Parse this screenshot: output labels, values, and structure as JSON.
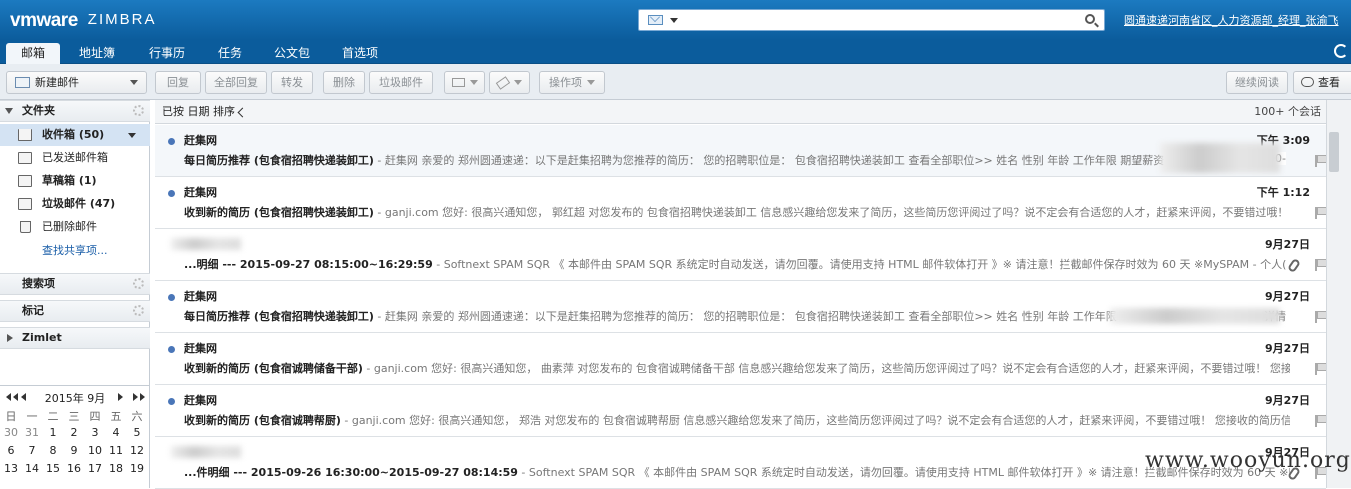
{
  "header": {
    "brand_vm": "vmware",
    "brand_zimbra": "ZIMBRA",
    "user": "圆通速递河南省区_人力资源部_经理_张渝飞",
    "search": {
      "placeholder": "",
      "type_icon": "mail-icon"
    }
  },
  "app_tabs": [
    {
      "label": "邮箱",
      "active": true
    },
    {
      "label": "地址簿",
      "active": false
    },
    {
      "label": "行事历",
      "active": false
    },
    {
      "label": "任务",
      "active": false
    },
    {
      "label": "公文包",
      "active": false
    },
    {
      "label": "首选项",
      "active": false
    }
  ],
  "toolbar": {
    "new_mail": "新建邮件",
    "reply": "回复",
    "reply_all": "全部回复",
    "forward": "转发",
    "delete": "删除",
    "junk": "垃圾邮件",
    "actions": "操作项",
    "continue_read": "继续阅读",
    "view": "查看"
  },
  "sidebar": {
    "folders_header": "文件夹",
    "folders": [
      {
        "label": "收件箱 (50)",
        "icon": "inbox-icon",
        "selected": true,
        "bold": true
      },
      {
        "label": "已发送邮件箱",
        "icon": "sent-icon",
        "selected": false,
        "bold": false
      },
      {
        "label": "草稿箱 (1)",
        "icon": "drafts-icon",
        "selected": false,
        "bold": true
      },
      {
        "label": "垃圾邮件 (47)",
        "icon": "junk-icon",
        "selected": false,
        "bold": true
      },
      {
        "label": "已删除邮件",
        "icon": "trash-icon",
        "selected": false,
        "bold": false
      }
    ],
    "find_shares": "查找共享项...",
    "searches_header": "搜索项",
    "tags_header": "标记",
    "zimlet_header": "Zimlet"
  },
  "calendar": {
    "title": "2015年 9月",
    "dow": [
      "日",
      "一",
      "二",
      "三",
      "四",
      "五",
      "六"
    ],
    "rows": [
      [
        {
          "d": "30",
          "other": true
        },
        {
          "d": "31",
          "other": true
        },
        {
          "d": "1"
        },
        {
          "d": "2"
        },
        {
          "d": "3"
        },
        {
          "d": "4"
        },
        {
          "d": "5"
        }
      ],
      [
        {
          "d": "6"
        },
        {
          "d": "7"
        },
        {
          "d": "8"
        },
        {
          "d": "9"
        },
        {
          "d": "10"
        },
        {
          "d": "11"
        },
        {
          "d": "12"
        }
      ],
      [
        {
          "d": "13"
        },
        {
          "d": "14"
        },
        {
          "d": "15"
        },
        {
          "d": "16"
        },
        {
          "d": "17"
        },
        {
          "d": "18"
        },
        {
          "d": "19"
        }
      ]
    ]
  },
  "list": {
    "sort_label": "已按 日期 排序",
    "count": "100+ 个会话",
    "messages": [
      {
        "from": "赶集网",
        "date": "下午 3:09",
        "unread": true,
        "subject": "每日简历推荐 (包食宿招聘快递装卸工)",
        "fragment": " - 赶集网 亲爱的 郑州圆通速递：以下是赶集招聘为您推荐的简历： 您的招聘职位是： 包食宿招聘快递装卸工 查看全部职位>> 姓名 性别 年龄 工作年限 期望薪资",
        "fragment_end": "000-",
        "attach": false
      },
      {
        "from": "赶集网",
        "date": "下午 1:12",
        "unread": true,
        "subject": "收到新的简历 (包食宿招聘快递装卸工)",
        "fragment": " - ganji.com 您好: 很高兴通知您， 郭红超 对您发布的 包食宿招聘快递装卸工 信息感兴趣给您发来了简历，这些简历您评阅过了吗？说不定会有合适您的人才，赶紧来评阅，不要错过哦！ 您接",
        "fragment_end": "",
        "attach": false
      },
      {
        "from": "",
        "date": "9月27日",
        "unread": false,
        "subject": "...明细 --- 2015-09-27 08:15:00~16:29:59",
        "fragment": " - Softnext SPAM SQR 《 本邮件由 SPAM SQR 系统定时自动发送，请勿回覆。请使用支持 HTML 邮件软体打开 》※ 请注意！拦截邮件保存时效为 60 天 ※MySPAM - 个人(",
        "fragment_end": "",
        "attach": true
      },
      {
        "from": "赶集网",
        "date": "9月27日",
        "unread": true,
        "subject": "每日简历推荐 (包食宿招聘快递装卸工)",
        "fragment": " - 赶集网 亲爱的 郑州圆通速递：以下是赶集招聘为您推荐的简历： 您的招聘职位是： 包食宿招聘快递装卸工 查看全部职位>> 姓名 性别 年龄 工作年限",
        "fragment_end": "详情",
        "attach": false
      },
      {
        "from": "赶集网",
        "date": "9月27日",
        "unread": true,
        "subject": "收到新的简历 (包食宿诚聘储备干部)",
        "fragment": " - ganji.com 您好: 很高兴通知您， 曲素萍 对您发布的 包食宿诚聘储备干部 信息感兴趣给您发来了简历，这些简历您评阅过了吗？说不定会有合适您的人才，赶紧来评阅，不要错过哦！ 您接收的",
        "fragment_end": "",
        "attach": false
      },
      {
        "from": "赶集网",
        "date": "9月27日",
        "unread": true,
        "subject": "收到新的简历 (包食宿诚聘帮厨)",
        "fragment": " - ganji.com 您好: 很高兴通知您， 郑浩 对您发布的 包食宿诚聘帮厨 信息感兴趣给您发来了简历，这些简历您评阅过了吗？说不定会有合适您的人才，赶紧来评阅，不要错过哦！ 您接收的简历信息：",
        "fragment_end": "",
        "attach": false
      },
      {
        "from": "",
        "date": "9月27日",
        "unread": false,
        "subject": "...件明细 --- 2015-09-26 16:30:00~2015-09-27 08:14:59",
        "fragment": " - Softnext SPAM SQR 《 本邮件由 SPAM SQR 系统定时自动发送，请勿回覆。请使用支持 HTML 邮件软体打开 》※ 请注意！拦截邮件保存时效为 60 天 ※My",
        "fragment_end": "",
        "attach": true
      }
    ]
  },
  "watermark": "www.wooyun.org"
}
